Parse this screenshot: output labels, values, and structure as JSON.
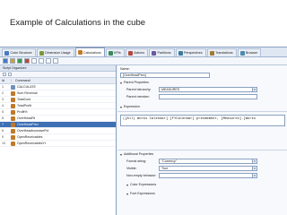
{
  "slide": {
    "title": "Example of Calculations in the cube"
  },
  "tabs": [
    {
      "label": "Cube Structure",
      "color": "#4a7ac0",
      "active": false
    },
    {
      "label": "Dimension Usage",
      "color": "#7a9a3a",
      "active": false
    },
    {
      "label": "Calculations",
      "color": "#c07a2a",
      "active": true
    },
    {
      "label": "KPIs",
      "color": "#3a8a5a",
      "active": false
    },
    {
      "label": "Actions",
      "color": "#b04a3a",
      "active": false
    },
    {
      "label": "Partitions",
      "color": "#6a5aa0",
      "active": false
    },
    {
      "label": "Perspectives",
      "color": "#3a7aa0",
      "active": false
    },
    {
      "label": "Translations",
      "color": "#a07a3a",
      "active": false
    },
    {
      "label": "Browser",
      "color": "#4a8ab0",
      "active": false
    }
  ],
  "left": {
    "header": "Script Organizer:",
    "col_id": "Id",
    "col_command": "Command",
    "rows": [
      {
        "id": "1",
        "label": "CALCULATE",
        "icon": "script-icon",
        "color": "#6f8fb8",
        "selected": false
      },
      {
        "id": "2",
        "label": "Sum Revenue",
        "icon": "calc-icon",
        "color": "#c07a2a",
        "selected": false
      },
      {
        "id": "3",
        "label": "TotalCost",
        "icon": "calc-icon",
        "color": "#c07a2a",
        "selected": false
      },
      {
        "id": "4",
        "label": "TotalProfit",
        "icon": "calc-icon",
        "color": "#c07a2a",
        "selected": false
      },
      {
        "id": "5",
        "label": "Profit%",
        "icon": "calc-icon",
        "color": "#c07a2a",
        "selected": false
      },
      {
        "id": "6",
        "label": "OverHeadRt",
        "icon": "calc-icon",
        "color": "#c07a2a",
        "selected": false
      },
      {
        "id": "7",
        "label": "OverHeadPrev",
        "icon": "calc-icon",
        "color": "#c07a2a",
        "selected": true
      },
      {
        "id": "8",
        "label": "OverHeadIncreasePct",
        "icon": "calc-icon",
        "color": "#c07a2a",
        "selected": false
      },
      {
        "id": "9",
        "label": "OpenReceivables",
        "icon": "calc-icon",
        "color": "#c07a2a",
        "selected": false
      },
      {
        "id": "10",
        "label": "OpenReceivablesYr",
        "icon": "calc-icon",
        "color": "#c07a2a",
        "selected": false
      }
    ]
  },
  "right": {
    "name_label": "Name:",
    "name_value": "[OverHeadPrev]",
    "parent_section": "Parent Properties",
    "parent_hierarchy_label": "Parent hierarchy:",
    "parent_hierarchy_value": "MEASURES",
    "parent_member_label": "Parent member:",
    "parent_member_value": "",
    "expression_section": "Expression",
    "expression_value": "([All) Works Calendar].[FYCalendar].prevmember, [Measures].[Works",
    "additional_section": "Additional Properties",
    "format_label": "Format string:",
    "format_value": "\"Currency\"",
    "visible_label": "Visible:",
    "visible_value": "True",
    "nonempty_label": "Non-empty behavior:",
    "nonempty_value": "",
    "color_section": "Color Expressions",
    "font_section": "Font Expressions"
  }
}
